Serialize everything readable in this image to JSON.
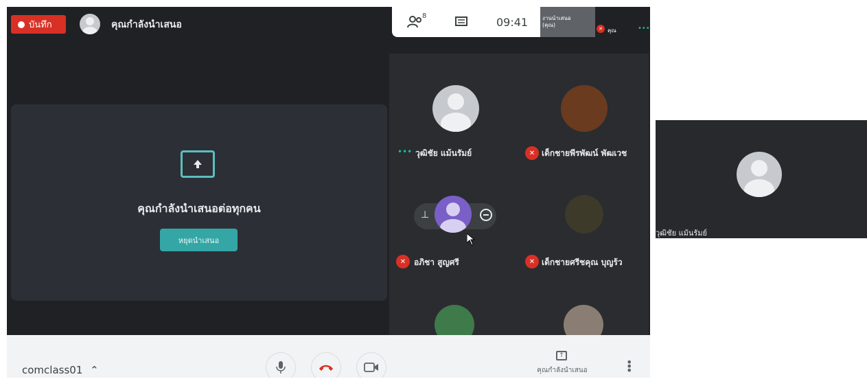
{
  "header": {
    "record_label": "บันทึก",
    "presenting_title": "คุณกำลังนำเสนอ"
  },
  "infobar": {
    "participants_count": "8",
    "time": "09:41",
    "self_tile_label": "งานนำเสนอ (คุณ)",
    "self_name": "คุณ",
    "more": "•••"
  },
  "presentation": {
    "message": "คุณกำลังนำเสนอต่อทุกคน",
    "stop_button": "หยุดนำเสนอ"
  },
  "participants": [
    {
      "name": "วุฒิชัย แม้นรัมย์",
      "status": "speaking-dots",
      "dots": "•••"
    },
    {
      "name": "เด็กชายพีรพัฒน์ พัฒเวช",
      "status": "muted"
    },
    {
      "name": "อภิชา สูญศรี",
      "status": "muted"
    },
    {
      "name": "เด็กชายศรีชคุณ บุญร้ว",
      "status": "muted"
    }
  ],
  "bottombar": {
    "meeting_code": "comclass01",
    "present_label": "คุณกำลังนำเสนอ"
  },
  "side_panel": {
    "name": "วุฒิชัย แม้นรัมย์"
  },
  "colors": {
    "record_red": "#d93025",
    "accent_teal": "#35a6a6",
    "meet_bg": "#202124"
  }
}
